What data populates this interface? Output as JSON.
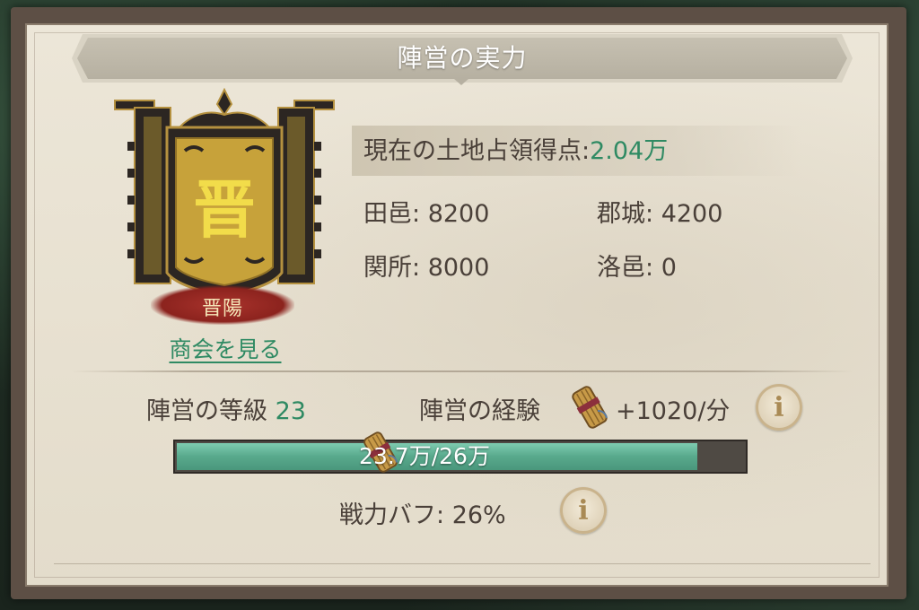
{
  "title": "陣営の実力",
  "emblem": {
    "character": "晋",
    "city": "晋陽",
    "link_label": "商会を見る"
  },
  "territory": {
    "label": "現在の土地占領得点:",
    "value": "2.04万"
  },
  "holdings": [
    {
      "label": "田邑:",
      "value": "8200"
    },
    {
      "label": "郡城:",
      "value": "4200"
    },
    {
      "label": "関所:",
      "value": "8000"
    },
    {
      "label": "洛邑:",
      "value": "0"
    }
  ],
  "faction": {
    "level_label": "陣営の等級",
    "level_value": "23",
    "exp_label": "陣営の経験",
    "exp_rate": "+1020/分",
    "progress_text": "23.7万/26万",
    "progress_fraction": 0.9115
  },
  "buff": {
    "label": "戦力バフ:",
    "value": "26%"
  },
  "icons": {
    "info": "info-icon",
    "bundle": "scroll-bundle-icon"
  },
  "colors": {
    "accent_green": "#2f8a63",
    "text_brown": "#4a4039",
    "banner_gold": "#e8c43a",
    "label_red": "#9c2a24"
  }
}
